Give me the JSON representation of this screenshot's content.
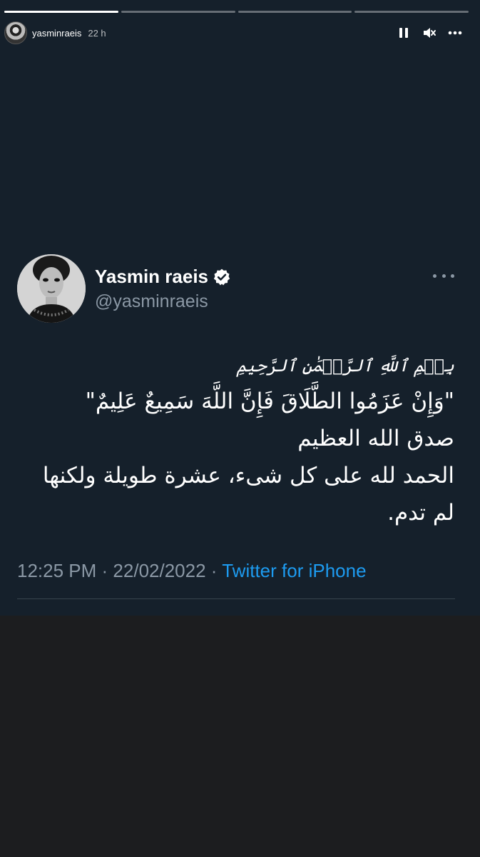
{
  "story": {
    "progress": [
      1.0,
      0.0,
      0.0,
      0.0
    ],
    "username": "yasminraeis",
    "time_ago": "22 h",
    "controls": [
      "pause-icon",
      "mute-icon",
      "more-icon"
    ]
  },
  "tweet": {
    "display_name": "Yasmin raeis",
    "handle": "@yasminraeis",
    "basmala": "بِسۡمِ ٱللَّهِ ٱلرَّحۡمَٰنِ ٱلرَّحِيمِ",
    "lines": [
      "\"وَإِنْ عَزَمُوا الطَّلَاقَ فَإِنَّ اللَّهَ سَمِيعٌ عَلِيمٌ\"",
      "صدق الله العظيم",
      "الحمد لله على كل شىء، عشرة طويلة ولكنها",
      "لم تدم."
    ],
    "time": "12:25 PM",
    "separator": "·",
    "date": "22/02/2022",
    "source": "Twitter for iPhone",
    "colors": {
      "background": "#15202b",
      "secondary_text": "#8b98a5",
      "link": "#1d9bf0",
      "verified": "#ffffff"
    }
  }
}
